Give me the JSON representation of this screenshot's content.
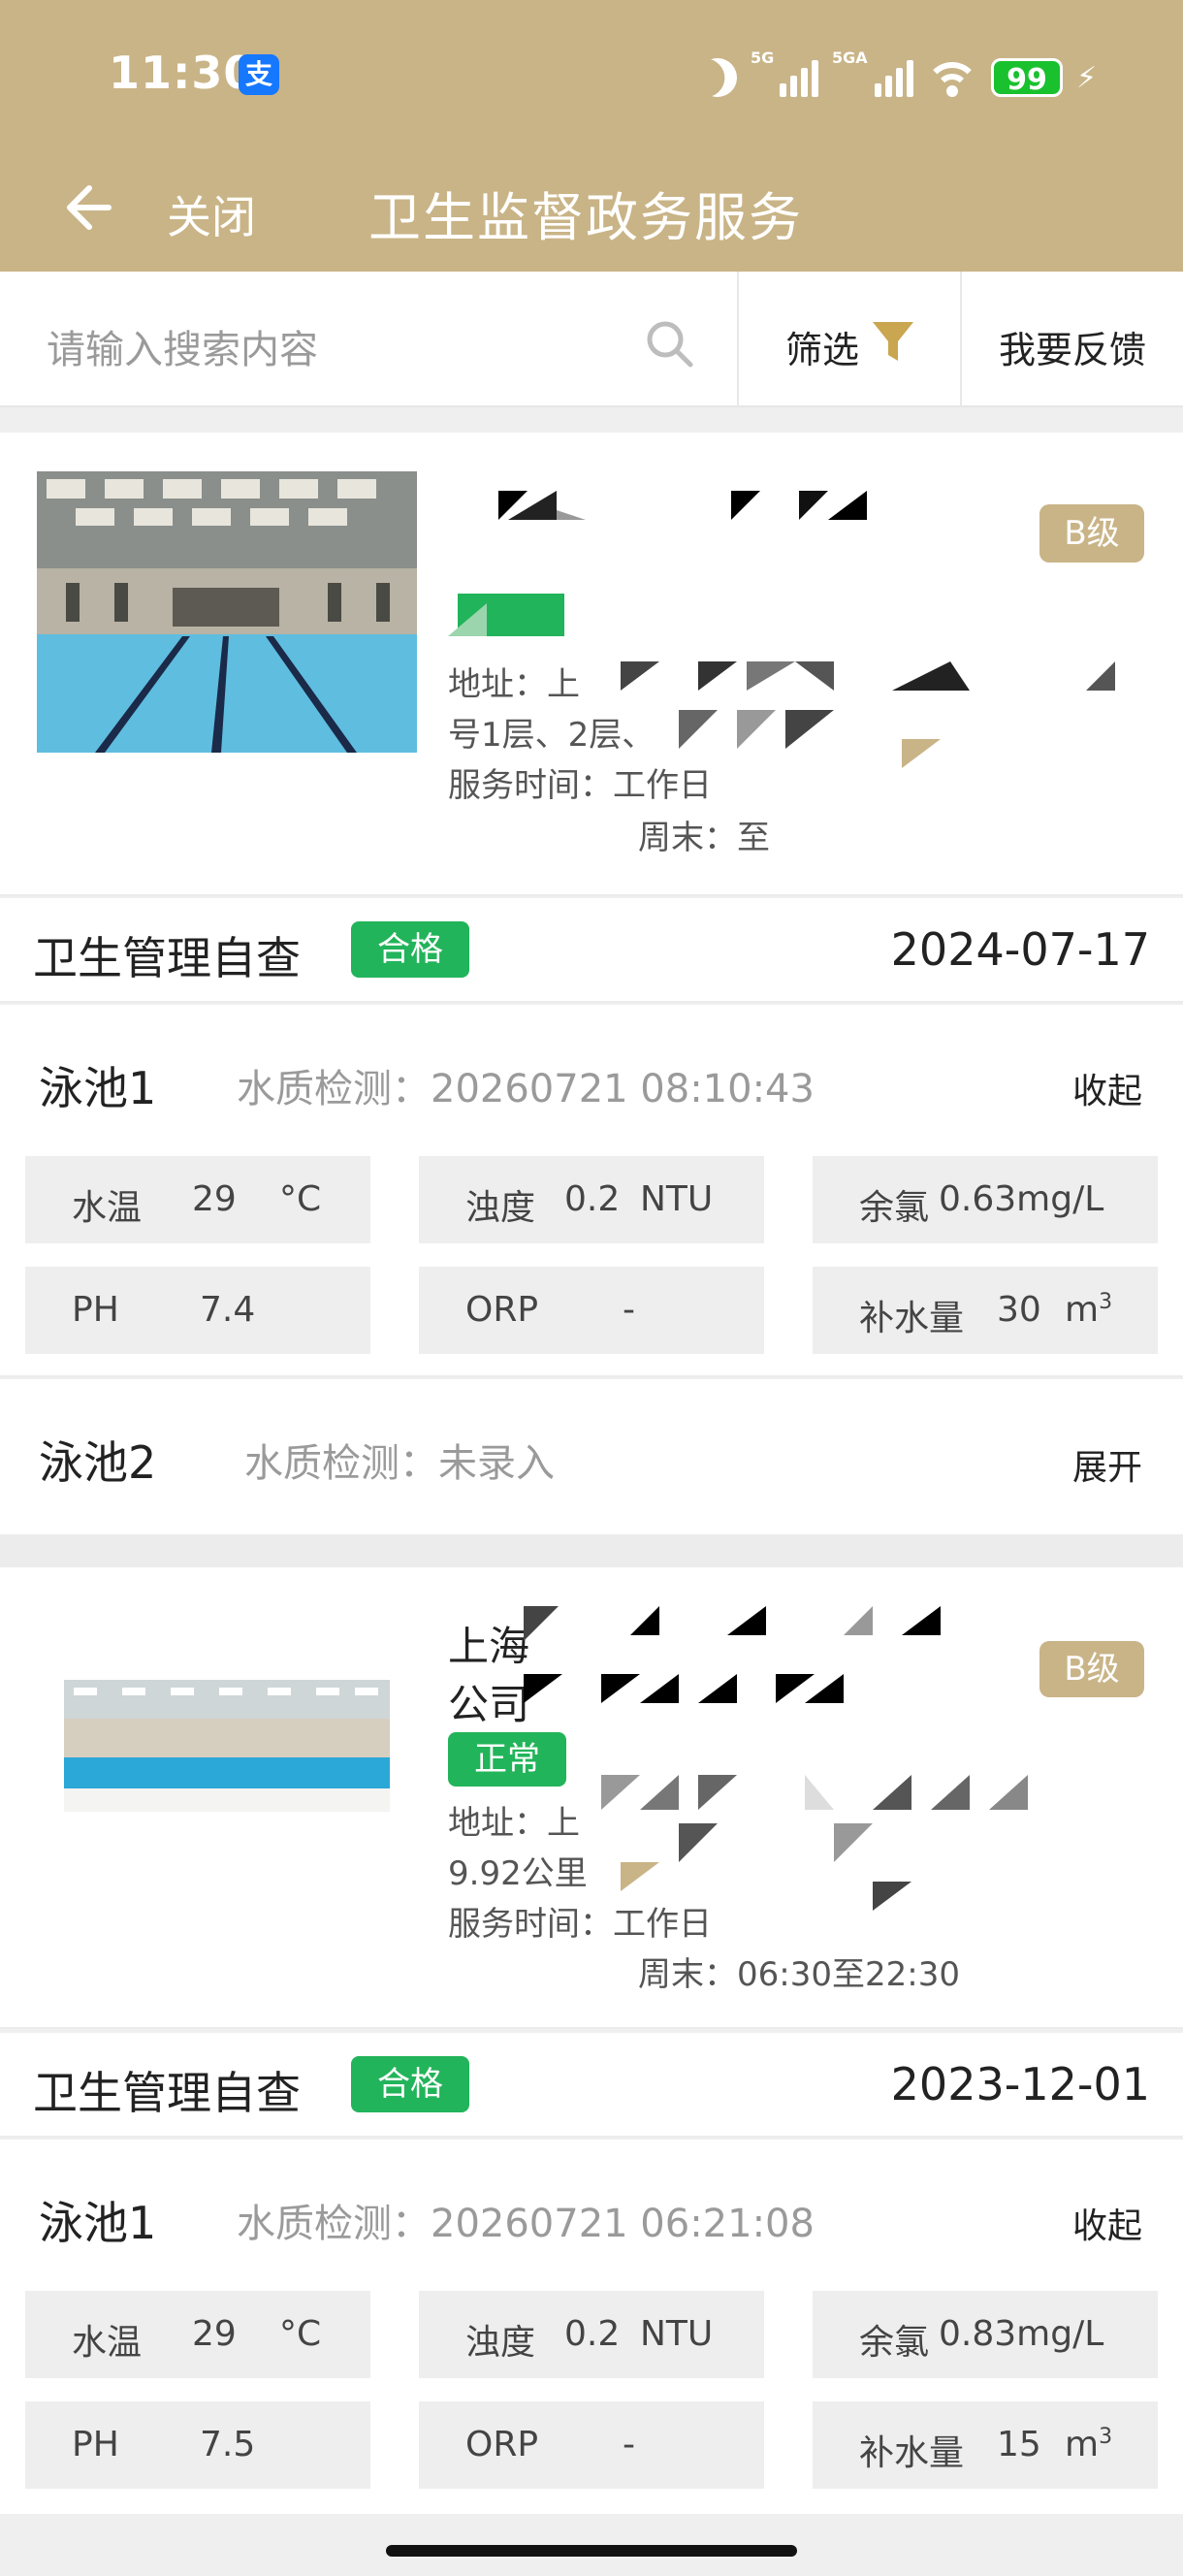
{
  "status_bar": {
    "time": "11:30",
    "app_icon": "支",
    "battery": "99",
    "signal1_label": "5G",
    "signal2_label": "5GA"
  },
  "nav": {
    "close_label": "关闭",
    "title": "卫生监督政务服务"
  },
  "toolbar": {
    "search_placeholder": "请输入搜索内容",
    "filter_label": "筛选",
    "feedback_label": "我要反馈"
  },
  "colors": {
    "header": "#c9b487",
    "pass_green": "#22b45a",
    "level_badge": "#c9b487"
  },
  "venues": [
    {
      "level": "B级",
      "address_prefix": "地址：上",
      "address_line2": "号1层、2层、",
      "service_time_label": "服务时间：工作日",
      "weekend_label": "周末：至",
      "check": {
        "title": "卫生管理自查",
        "result": "合格",
        "date": "2024-07-17"
      },
      "pools": [
        {
          "name": "泳池1",
          "detection": "水质检测：20260721 08:10:43",
          "action": "收起",
          "metrics": {
            "water_temp": {
              "label": "水温",
              "value": "29",
              "unit": "°C"
            },
            "turbidity": {
              "label": "浊度",
              "value": "0.2",
              "unit": "NTU"
            },
            "chlorine": {
              "label": "余氯",
              "value": "0.63mg/L"
            },
            "ph": {
              "label": "PH",
              "value": "7.4"
            },
            "orp": {
              "label": "ORP",
              "value": "-"
            },
            "refill": {
              "label": "补水量",
              "value": "30",
              "unit": "m"
            }
          }
        },
        {
          "name": "泳池2",
          "detection": "水质检测：未录入",
          "action": "展开"
        }
      ]
    },
    {
      "level": "B级",
      "name_line1": "上海",
      "name_line2": "公司",
      "status": "正常",
      "address_prefix": "地址：上",
      "address_line2": "9.92公里",
      "service_time_label": "服务时间：工作日",
      "weekend_label": "周末：06:30至22:30",
      "check": {
        "title": "卫生管理自查",
        "result": "合格",
        "date": "2023-12-01"
      },
      "pools": [
        {
          "name": "泳池1",
          "detection": "水质检测：20260721 06:21:08",
          "action": "收起",
          "metrics": {
            "water_temp": {
              "label": "水温",
              "value": "29",
              "unit": "°C"
            },
            "turbidity": {
              "label": "浊度",
              "value": "0.2",
              "unit": "NTU"
            },
            "chlorine": {
              "label": "余氯",
              "value": "0.83mg/L"
            },
            "ph": {
              "label": "PH",
              "value": "7.5"
            },
            "orp": {
              "label": "ORP",
              "value": "-"
            },
            "refill": {
              "label": "补水量",
              "value": "15",
              "unit": "m"
            }
          }
        }
      ]
    }
  ]
}
